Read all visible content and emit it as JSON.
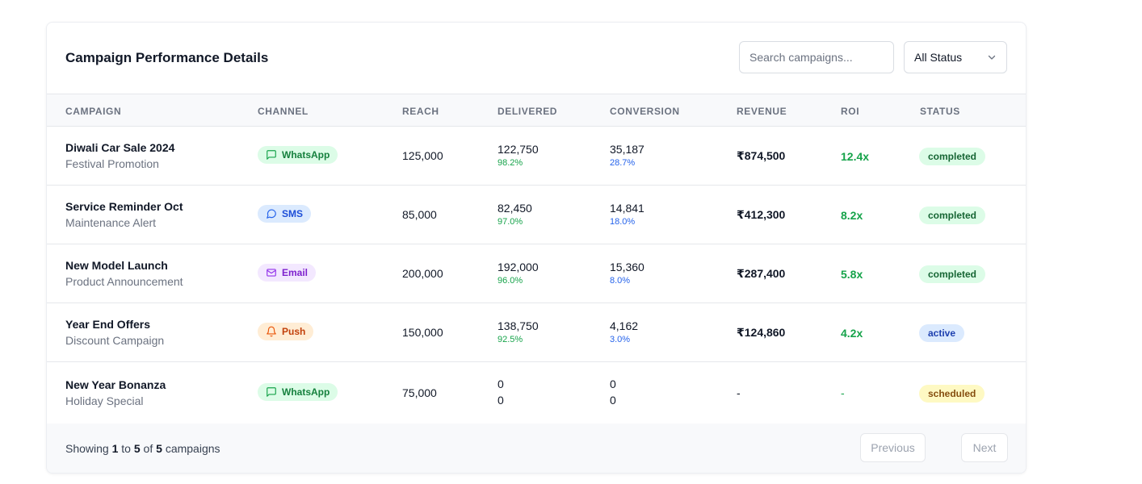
{
  "header": {
    "title": "Campaign Performance Details",
    "search_placeholder": "Search campaigns...",
    "status_filter": "All Status"
  },
  "columns": [
    "CAMPAIGN",
    "CHANNEL",
    "REACH",
    "DELIVERED",
    "CONVERSION",
    "REVENUE",
    "ROI",
    "STATUS"
  ],
  "rows": [
    {
      "name": "Diwali Car Sale 2024",
      "type": "Festival Promotion",
      "channel": "WhatsApp",
      "channel_icon": "message-square-icon",
      "reach": "125,000",
      "delivered": "122,750",
      "delivered_pct": "98.2%",
      "conversion": "35,187",
      "conversion_pct": "28.7%",
      "revenue": "₹874,500",
      "roi": "12.4x",
      "status": "completed"
    },
    {
      "name": "Service Reminder Oct",
      "type": "Maintenance Alert",
      "channel": "SMS",
      "channel_icon": "message-circle-icon",
      "reach": "85,000",
      "delivered": "82,450",
      "delivered_pct": "97.0%",
      "conversion": "14,841",
      "conversion_pct": "18.0%",
      "revenue": "₹412,300",
      "roi": "8.2x",
      "status": "completed"
    },
    {
      "name": "New Model Launch",
      "type": "Product Announcement",
      "channel": "Email",
      "channel_icon": "mail-icon",
      "reach": "200,000",
      "delivered": "192,000",
      "delivered_pct": "96.0%",
      "conversion": "15,360",
      "conversion_pct": "8.0%",
      "revenue": "₹287,400",
      "roi": "5.8x",
      "status": "completed"
    },
    {
      "name": "Year End Offers",
      "type": "Discount Campaign",
      "channel": "Push",
      "channel_icon": "bell-icon",
      "reach": "150,000",
      "delivered": "138,750",
      "delivered_pct": "92.5%",
      "conversion": "4,162",
      "conversion_pct": "3.0%",
      "revenue": "₹124,860",
      "roi": "4.2x",
      "status": "active"
    },
    {
      "name": "New Year Bonanza",
      "type": "Holiday Special",
      "channel": "WhatsApp",
      "channel_icon": "message-square-icon",
      "reach": "75,000",
      "delivered": "0",
      "delivered_pct": "0",
      "conversion": "0",
      "conversion_pct": "0",
      "revenue": "-",
      "roi": "-",
      "status": "scheduled"
    }
  ],
  "footer": {
    "showing_prefix": "Showing",
    "from": "1",
    "to_word": "to",
    "to": "5",
    "of_word": "of",
    "total": "5",
    "suffix": "campaigns",
    "previous": "Previous",
    "next": "Next"
  }
}
